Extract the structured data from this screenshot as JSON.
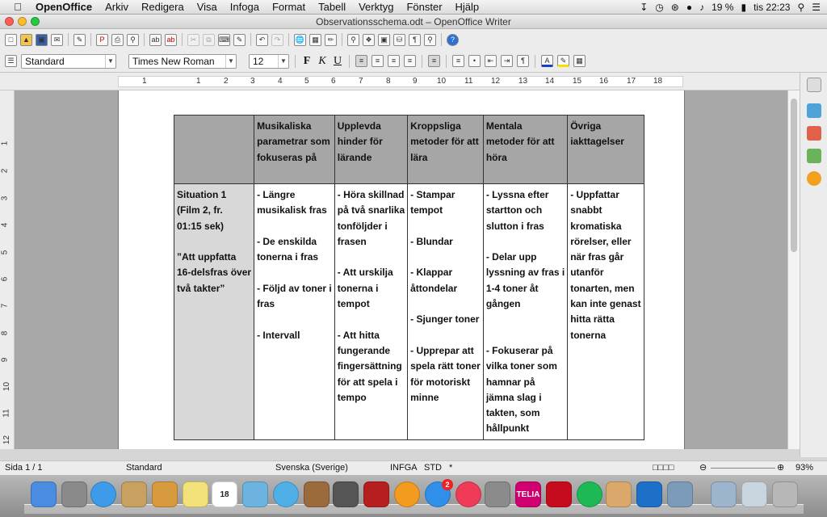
{
  "menubar": {
    "app_name": "OpenOffice",
    "items": [
      "Arkiv",
      "Redigera",
      "Visa",
      "Infoga",
      "Format",
      "Tabell",
      "Verktyg",
      "Fönster",
      "Hjälp"
    ],
    "battery": "19 %",
    "clock": "tis 22:23"
  },
  "window": {
    "title": "Observationsschema.odt – OpenOffice Writer"
  },
  "formatting": {
    "paragraph_style": "Standard",
    "font_name": "Times New Roman",
    "font_size": "12",
    "bold_label": "F",
    "italic_label": "K",
    "underline_label": "U"
  },
  "ruler": {
    "labels": [
      "1",
      "1",
      "2",
      "3",
      "4",
      "5",
      "6",
      "7",
      "8",
      "9",
      "10",
      "11",
      "12",
      "13",
      "14",
      "15",
      "16",
      "17",
      "18"
    ],
    "vertical_labels": [
      "1",
      "2",
      "3",
      "4",
      "5",
      "6",
      "7",
      "8",
      "9",
      "10",
      "11",
      "12"
    ]
  },
  "table": {
    "headers": [
      "",
      "Musikaliska parametrar som fokuseras på",
      "Upplevda hinder för lärande",
      "Kroppsliga metoder för att lära",
      "Mentala metoder för att höra",
      "Övriga iakttagelser"
    ],
    "header_lines": [
      [],
      [
        "Musikaliska",
        "parametrar som",
        "fokuseras på"
      ],
      [
        "Upplevda",
        "hinder för",
        "lärande"
      ],
      [
        "Kroppsliga",
        "metoder för att",
        "lära"
      ],
      [
        "Mentala",
        "metoder för att",
        "höra"
      ],
      [
        "Övriga",
        "iakttagelser"
      ]
    ],
    "row_cells": [
      [
        "Situation 1",
        "(Film 2, fr.",
        "01:15 sek)",
        "",
        "”Att uppfatta",
        "16-delsfras över",
        "två takter”"
      ],
      [
        "- Längre",
        "musikalisk fras",
        "",
        "- De enskilda",
        "tonerna i fras",
        "",
        "- Följd av toner i",
        "fras",
        "",
        "- Intervall"
      ],
      [
        "- Höra skillnad",
        "på två snarlika",
        "tonföljder i",
        "frasen",
        "",
        "- Att urskilja",
        "tonerna i",
        "tempot",
        "",
        "- Att hitta",
        "fungerande",
        "fingersättning",
        "för att spela i",
        "tempo"
      ],
      [
        "- Stampar",
        "tempot",
        "",
        "- Blundar",
        "",
        "- Klappar",
        "åttondelar",
        "",
        "- Sjunger toner",
        "",
        "- Upprepar att",
        "spela rätt toner",
        "för motoriskt",
        "minne"
      ],
      [
        "- Lyssna efter",
        "startton och",
        "slutton i fras",
        "",
        "- Delar upp",
        "lyssning av fras i",
        "1-4 toner åt",
        "gången",
        "",
        "",
        "- Fokuserar på",
        "vilka toner som",
        "hamnar på",
        "jämna slag i",
        "takten, som",
        "hållpunkt"
      ],
      [
        "- Uppfattar",
        "snabbt",
        "kromatiska",
        "rörelser, eller",
        "när fras går",
        "utanför",
        "tonarten, men",
        "kan inte genast",
        "hitta rätta",
        "tonerna"
      ]
    ]
  },
  "statusbar": {
    "page": "Sida   1 / 1",
    "style": "Standard",
    "language": "Svenska (Sverige)",
    "insert_mode": "INFGA",
    "selection_mode": "STD",
    "modified": "*",
    "zoom": "93%"
  },
  "dock": {
    "calendar_day": "18",
    "appstore_badge": "2",
    "telia_label": "TELIA"
  },
  "colors": {
    "header_fill": "#a6a6a6",
    "rowhead_fill": "#d8d8d8",
    "page": "#ffffff",
    "workarea": "#a8a8a8"
  }
}
